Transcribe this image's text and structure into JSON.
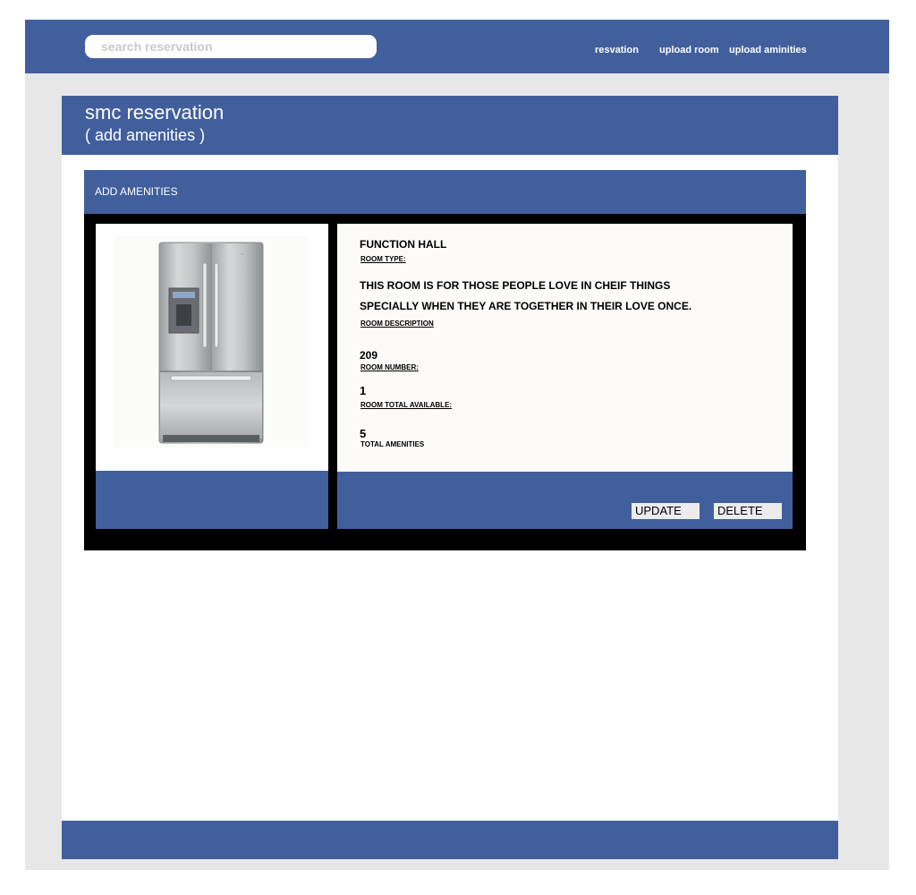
{
  "search": {
    "placeholder": "search reservation"
  },
  "nav": {
    "reservation": "resvation",
    "upload_room": "upload room",
    "upload_amenities": "upload aminities"
  },
  "header": {
    "title": "smc reservation",
    "subtitle": "( add amenities )"
  },
  "panel": {
    "title": "ADD AMENITIES"
  },
  "amenity": {
    "image_icon": "refrigerator-image",
    "room_type_value": "FUNCTION HALL",
    "room_type_label": "ROOM TYPE:",
    "description_line1": "THIS ROOM IS FOR THOSE PEOPLE LOVE IN CHEIF THINGS",
    "description_line2": "SPECIALLY WHEN THEY ARE TOGETHER IN THEIR LOVE ONCE.",
    "description_label": "ROOM DESCRIPTION",
    "room_number_value": "209",
    "room_number_label": "ROOM NUMBER:",
    "total_available_value": "1",
    "total_available_label": "ROOM TOTAL AVAILABLE:",
    "total_amenities_value": "5",
    "total_amenities_label": "TOTAL AMENITIES"
  },
  "actions": {
    "update": "UPDATE",
    "delete": "DELETE"
  },
  "colors": {
    "brand": "#415f9d",
    "background": "#e7e7e7",
    "panel": "#000000"
  }
}
